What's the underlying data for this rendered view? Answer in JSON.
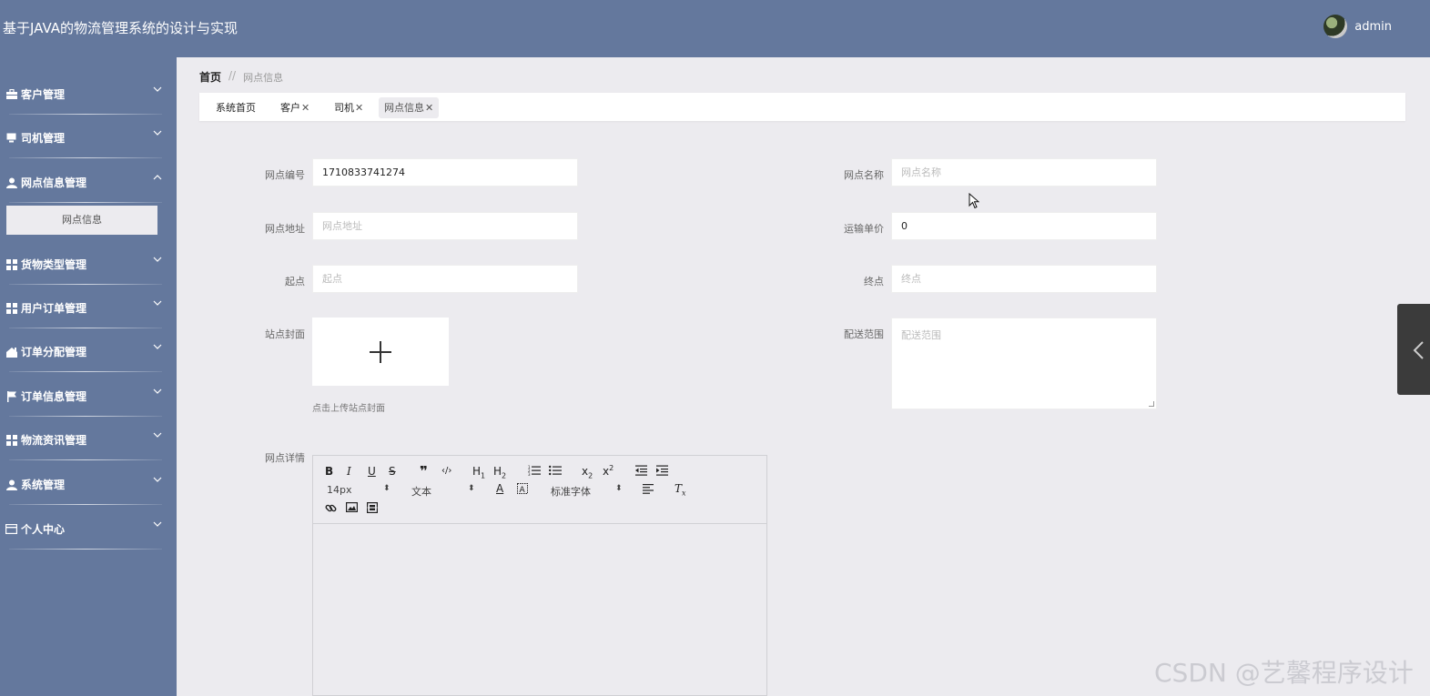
{
  "header": {
    "title": "基于JAVA的物流管理系统的设计与实现",
    "username": "admin"
  },
  "sidebar": {
    "items": [
      {
        "label": "客户管理",
        "icon": "briefcase-icon",
        "expanded": false
      },
      {
        "label": "司机管理",
        "icon": "monitor-icon",
        "expanded": false
      },
      {
        "label": "网点信息管理",
        "icon": "user-icon",
        "expanded": true,
        "children": [
          {
            "label": "网点信息",
            "active": true
          }
        ]
      },
      {
        "label": "货物类型管理",
        "icon": "grid-icon",
        "expanded": false
      },
      {
        "label": "用户订单管理",
        "icon": "grid-icon",
        "expanded": false
      },
      {
        "label": "订单分配管理",
        "icon": "home-icon",
        "expanded": false
      },
      {
        "label": "订单信息管理",
        "icon": "flag-icon",
        "expanded": false
      },
      {
        "label": "物流资讯管理",
        "icon": "grid-icon",
        "expanded": false
      },
      {
        "label": "系统管理",
        "icon": "user-icon",
        "expanded": false
      },
      {
        "label": "个人中心",
        "icon": "card-icon",
        "expanded": false
      }
    ]
  },
  "breadcrumb": {
    "home": "首页",
    "separator": "//",
    "current": "网点信息"
  },
  "tabs": [
    {
      "label": "系统首页",
      "closable": false,
      "active": false
    },
    {
      "label": "客户",
      "closable": true,
      "active": false
    },
    {
      "label": "司机",
      "closable": true,
      "active": false
    },
    {
      "label": "网点信息",
      "closable": true,
      "active": true
    }
  ],
  "form": {
    "site_no": {
      "label": "网点编号",
      "value": "1710833741274"
    },
    "site_name": {
      "label": "网点名称",
      "placeholder": "网点名称"
    },
    "site_address": {
      "label": "网点地址",
      "placeholder": "网点地址"
    },
    "unit_price": {
      "label": "运输单价",
      "value": "0"
    },
    "start": {
      "label": "起点",
      "placeholder": "起点"
    },
    "end": {
      "label": "终点",
      "placeholder": "终点"
    },
    "cover": {
      "label": "站点封面",
      "hint": "点击上传站点封面"
    },
    "range": {
      "label": "配送范围",
      "placeholder": "配送范围"
    },
    "detail": {
      "label": "网点详情"
    }
  },
  "editor": {
    "font_size": "14px",
    "header_type": "文本",
    "font_family": "标准字体"
  },
  "watermark": "CSDN @艺馨程序设计",
  "colors": {
    "primary": "#64789d",
    "background": "#ecebef"
  }
}
